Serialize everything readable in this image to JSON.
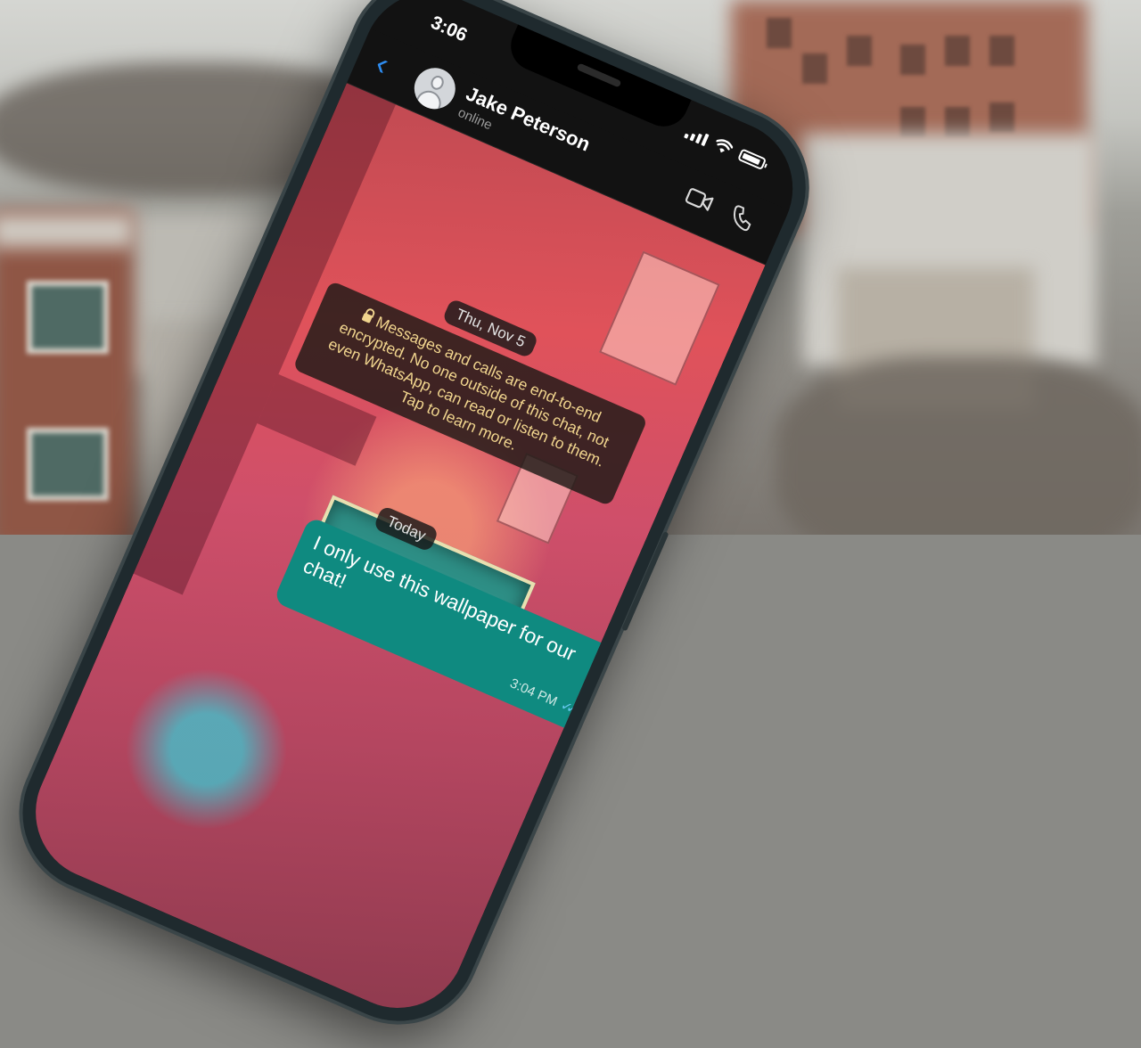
{
  "status_bar": {
    "time": "3:06",
    "signal_icon": "signal-icon",
    "wifi_icon": "wifi-icon",
    "battery_icon": "battery-icon"
  },
  "header": {
    "back_icon": "chevron-left-icon",
    "contact_name": "Jake Peterson",
    "contact_status": "online",
    "video_icon": "video-camera-icon",
    "call_icon": "phone-icon"
  },
  "chat": {
    "date_label": "Thu, Nov 5",
    "encryption_notice": "Messages and calls are end-to-end encrypted. No one outside of this chat, not even WhatsApp, can read or listen to them. Tap to learn more.",
    "today_label": "Today",
    "messages": [
      {
        "text": "I only use this wallpaper for our chat!",
        "time": "3:04 PM",
        "read_icon": "double-check-icon"
      }
    ]
  },
  "colors": {
    "accent": "#2e8cf0",
    "bubble_outgoing": "#0f8a80",
    "notice_text": "#f1d58e"
  }
}
